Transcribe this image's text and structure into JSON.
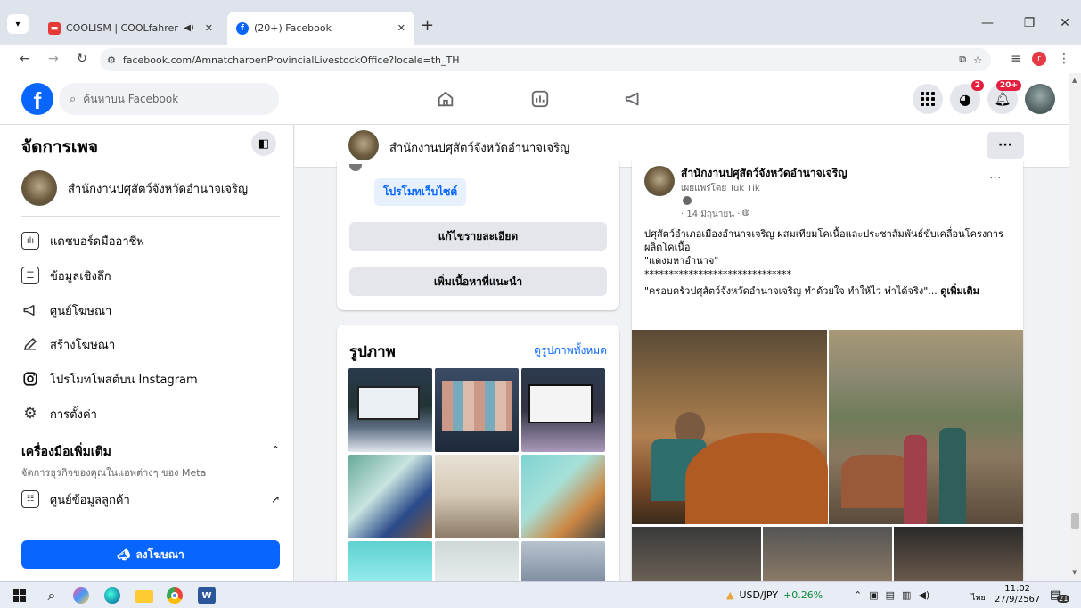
{
  "browser": {
    "tabs": [
      {
        "title": "COOLISM | COOLfahrenheit"
      },
      {
        "title": "(20+) Facebook"
      }
    ],
    "url": "facebook.com/AmnatcharoenProvincialLivestockOffice?locale=th_TH"
  },
  "fb_header": {
    "search_placeholder": "ค้นหาบน Facebook",
    "messenger_badge": "2",
    "notifications_badge": "20+"
  },
  "sidebar": {
    "title": "จัดการเพจ",
    "page_name": "สำนักงานปศุสัตว์จังหวัดอำนาจเจริญ",
    "items": [
      {
        "label": "แดชบอร์ดมืออาชีพ",
        "icon": "dashboard-icon"
      },
      {
        "label": "ข้อมูลเชิงลึก",
        "icon": "insights-icon"
      },
      {
        "label": "ศูนย์โฆษณา",
        "icon": "megaphone-icon"
      },
      {
        "label": "สร้างโฆษณา",
        "icon": "pencil-icon"
      },
      {
        "label": "โปรโมทโพสต์บน Instagram",
        "icon": "instagram-icon"
      },
      {
        "label": "การตั้งค่า",
        "icon": "gear-icon"
      }
    ],
    "tools_title": "เครื่องมือเพิ่มเติม",
    "tools_subtitle": "จัดการธุรกิจของคุณในแอพต่างๆ ของ Meta",
    "customer_center": "ศูนย์ข้อมูลลูกค้า",
    "advertise_button": "ลงโฆษณา"
  },
  "page_header": {
    "name": "สำนักงานปศุสัตว์จังหวัดอำนาจเจริญ",
    "more": "···"
  },
  "about_card": {
    "promote_website": "โปรโมทเว็บไซต์",
    "edit_details": "แก้ไขรายละเอียด",
    "add_featured": "เพิ่มเนื้อหาที่แนะนำ"
  },
  "photos_card": {
    "title": "รูปภาพ",
    "see_all": "ดูรูปภาพทั้งหมด"
  },
  "post": {
    "author": "สำนักงานปศุสัตว์จังหวัดอำนาจเจริญ",
    "published_by": "เผยแพร่โดย Tuk Tik",
    "date": "· 14 มิถุนายน ·",
    "line1": "ปศุสัตว์อำเภอเมืองอำนาจเจริญ ผสมเทียมโคเนื้อและประชาสัมพันธ์ขับเคลื่อนโครงการผลิตโคเนื้อ",
    "line2": "\"แดงมหาอำนาจ\"",
    "line3": "******************************",
    "line4": "\"ครอบครัวปศุสัตว์จังหวัดอำนาจเจริญ ทำด้วยใจ ทำให้ไว ทำได้จริง\"...",
    "see_more": "ดูเพิ่มเติม",
    "more": "···"
  },
  "taskbar": {
    "ticker": "USD/JPY",
    "ticker_change": "+0.26%",
    "lang": "ไทย",
    "time": "11:02",
    "date": "27/9/2567",
    "notif_count": "21"
  }
}
